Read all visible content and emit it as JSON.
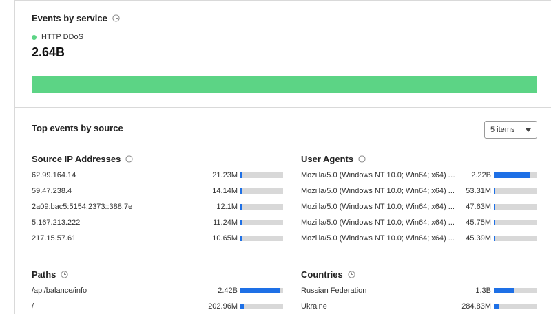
{
  "events_by_service": {
    "title": "Events by service",
    "legend": {
      "label": "HTTP DDoS",
      "color": "#5cd485"
    },
    "total": "2.64B",
    "bar_fraction": 1.0
  },
  "top_events": {
    "title": "Top events by source",
    "items_select": {
      "value": "5 items"
    },
    "source_ips": {
      "title": "Source IP Addresses",
      "rows": [
        {
          "label": "62.99.164.14",
          "value": "21.23M",
          "fraction": 0.01
        },
        {
          "label": "59.47.238.4",
          "value": "14.14M",
          "fraction": 0.006
        },
        {
          "label": "2a09:bac5:5154:2373::388:7e",
          "value": "12.1M",
          "fraction": 0.005
        },
        {
          "label": "5.167.213.222",
          "value": "11.24M",
          "fraction": 0.005
        },
        {
          "label": "217.15.57.61",
          "value": "10.65M",
          "fraction": 0.004
        }
      ]
    },
    "user_agents": {
      "title": "User Agents",
      "rows": [
        {
          "label": "Mozilla/5.0 (Windows NT 10.0; Win64; x64) A...",
          "value": "2.22B",
          "fraction": 0.84
        },
        {
          "label": "Mozilla/5.0 (Windows NT 10.0; Win64; x64) ...",
          "value": "53.31M",
          "fraction": 0.02
        },
        {
          "label": "Mozilla/5.0 (Windows NT 10.0; Win64; x64) ...",
          "value": "47.63M",
          "fraction": 0.018
        },
        {
          "label": "Mozilla/5.0 (Windows NT 10.0; Win64; x64) ...",
          "value": "45.75M",
          "fraction": 0.017
        },
        {
          "label": "Mozilla/5.0 (Windows NT 10.0; Win64; x64) ...",
          "value": "45.39M",
          "fraction": 0.017
        }
      ]
    },
    "paths": {
      "title": "Paths",
      "rows": [
        {
          "label": "/api/balance/info",
          "value": "2.42B",
          "fraction": 0.92
        },
        {
          "label": "/",
          "value": "202.96M",
          "fraction": 0.077
        }
      ]
    },
    "countries": {
      "title": "Countries",
      "rows": [
        {
          "label": "Russian Federation",
          "value": "1.3B",
          "fraction": 0.49
        },
        {
          "label": "Ukraine",
          "value": "284.83M",
          "fraction": 0.108
        }
      ]
    }
  }
}
